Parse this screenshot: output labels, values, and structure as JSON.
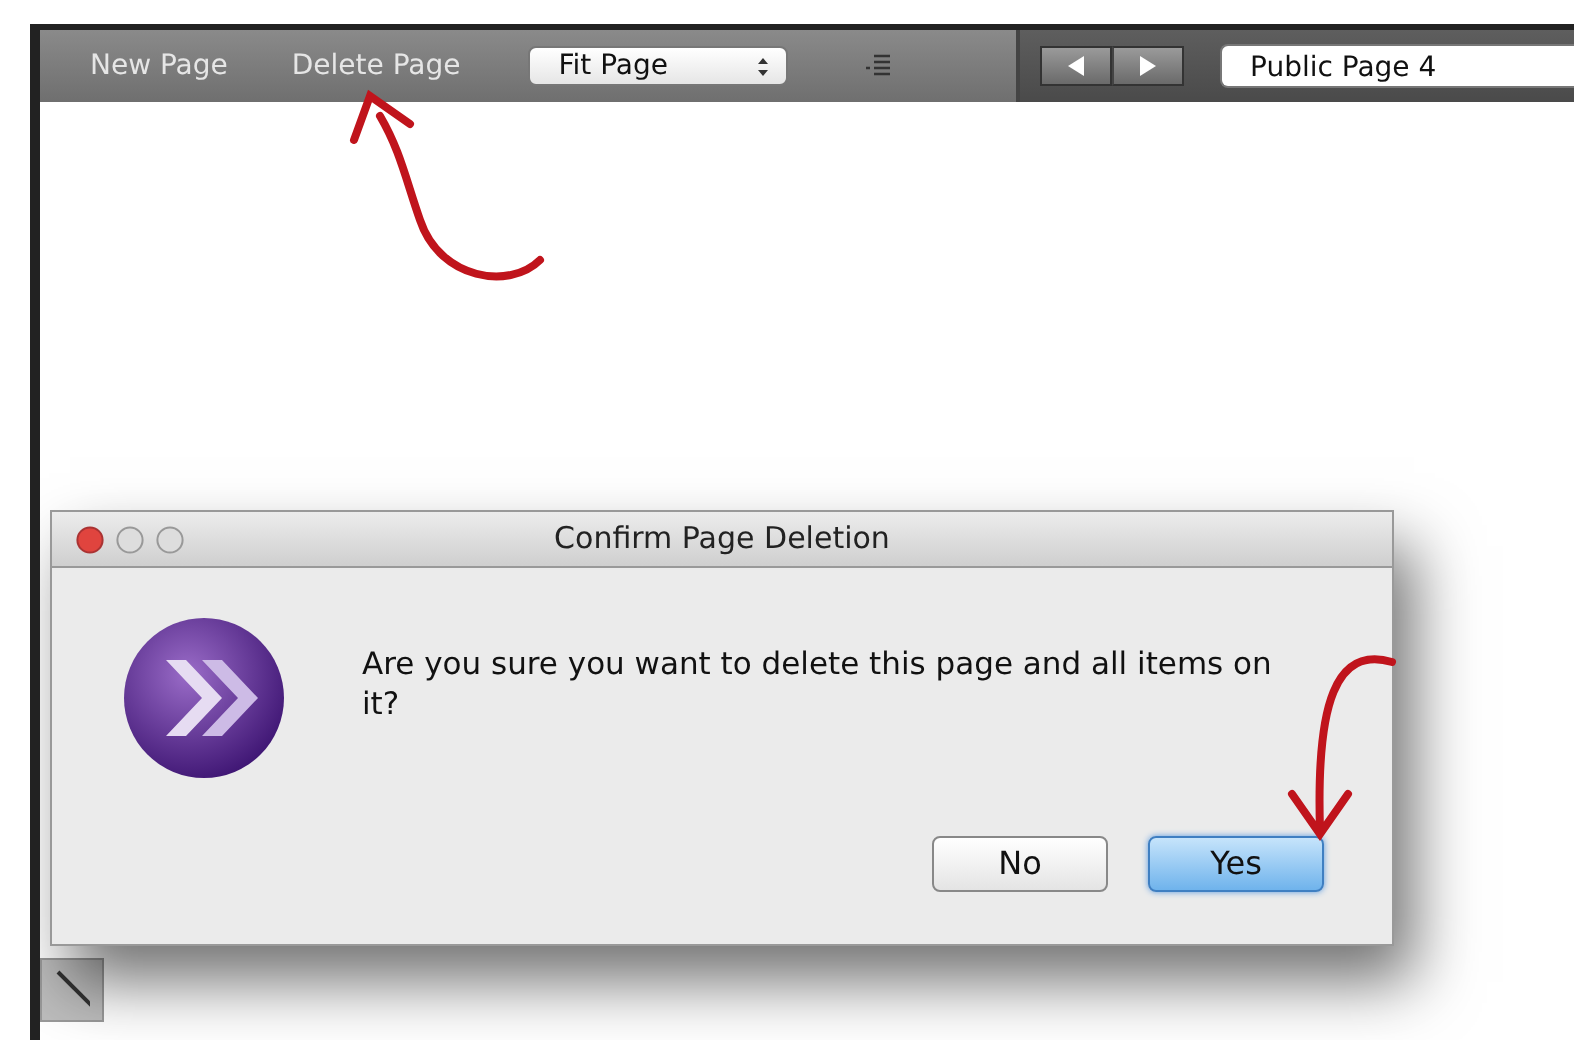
{
  "toolbar": {
    "items": [
      {
        "label": "New Page"
      },
      {
        "label": "Delete Page"
      }
    ],
    "zoom_select": {
      "value": "Fit Page"
    },
    "page_field": {
      "value": "Public Page 4"
    }
  },
  "dialog": {
    "title": "Confirm Page Deletion",
    "message": "Are you sure you want to delete this page and all items on it?",
    "buttons": [
      {
        "label": "No",
        "default": false
      },
      {
        "label": "Yes",
        "default": true
      }
    ]
  }
}
